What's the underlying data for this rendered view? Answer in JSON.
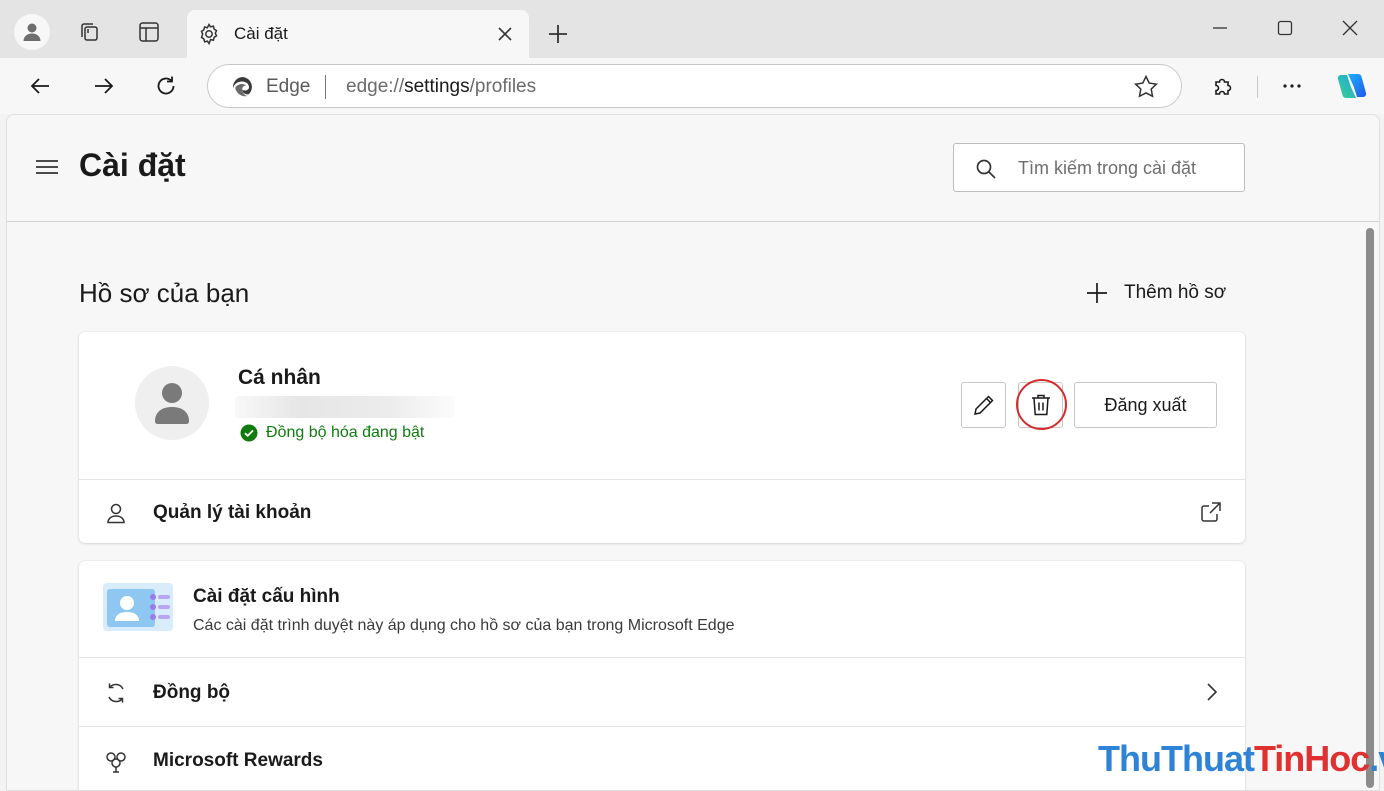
{
  "browser": {
    "tab": {
      "title": "Cài đặt"
    },
    "address": {
      "browser_label": "Edge",
      "url_prefix": "edge://",
      "url_host": "settings",
      "url_path": "/profiles"
    }
  },
  "settings": {
    "title": "Cài đặt",
    "search_placeholder": "Tìm kiếm trong cài đặt",
    "section_title": "Hồ sơ của bạn",
    "add_profile_label": "Thêm hồ sơ"
  },
  "profile": {
    "name": "Cá nhân",
    "sync_status": "Đồng bộ hóa đang bật",
    "signout_label": "Đăng xuất",
    "manage_account_label": "Quản lý tài khoản"
  },
  "profile_settings": {
    "config_title": "Cài đặt cấu hình",
    "config_desc": "Các cài đặt trình duyệt này áp dụng cho hồ sơ của bạn trong Microsoft Edge",
    "sync_label": "Đồng bộ",
    "rewards_label": "Microsoft Rewards"
  },
  "watermark": {
    "part1": "ThuThuat",
    "part2": "TinHoc",
    "part3": ".vn"
  },
  "colors": {
    "sync_green": "#107c10",
    "highlight_red": "#d62b2b",
    "edge_blue": "#1b7fd1"
  }
}
